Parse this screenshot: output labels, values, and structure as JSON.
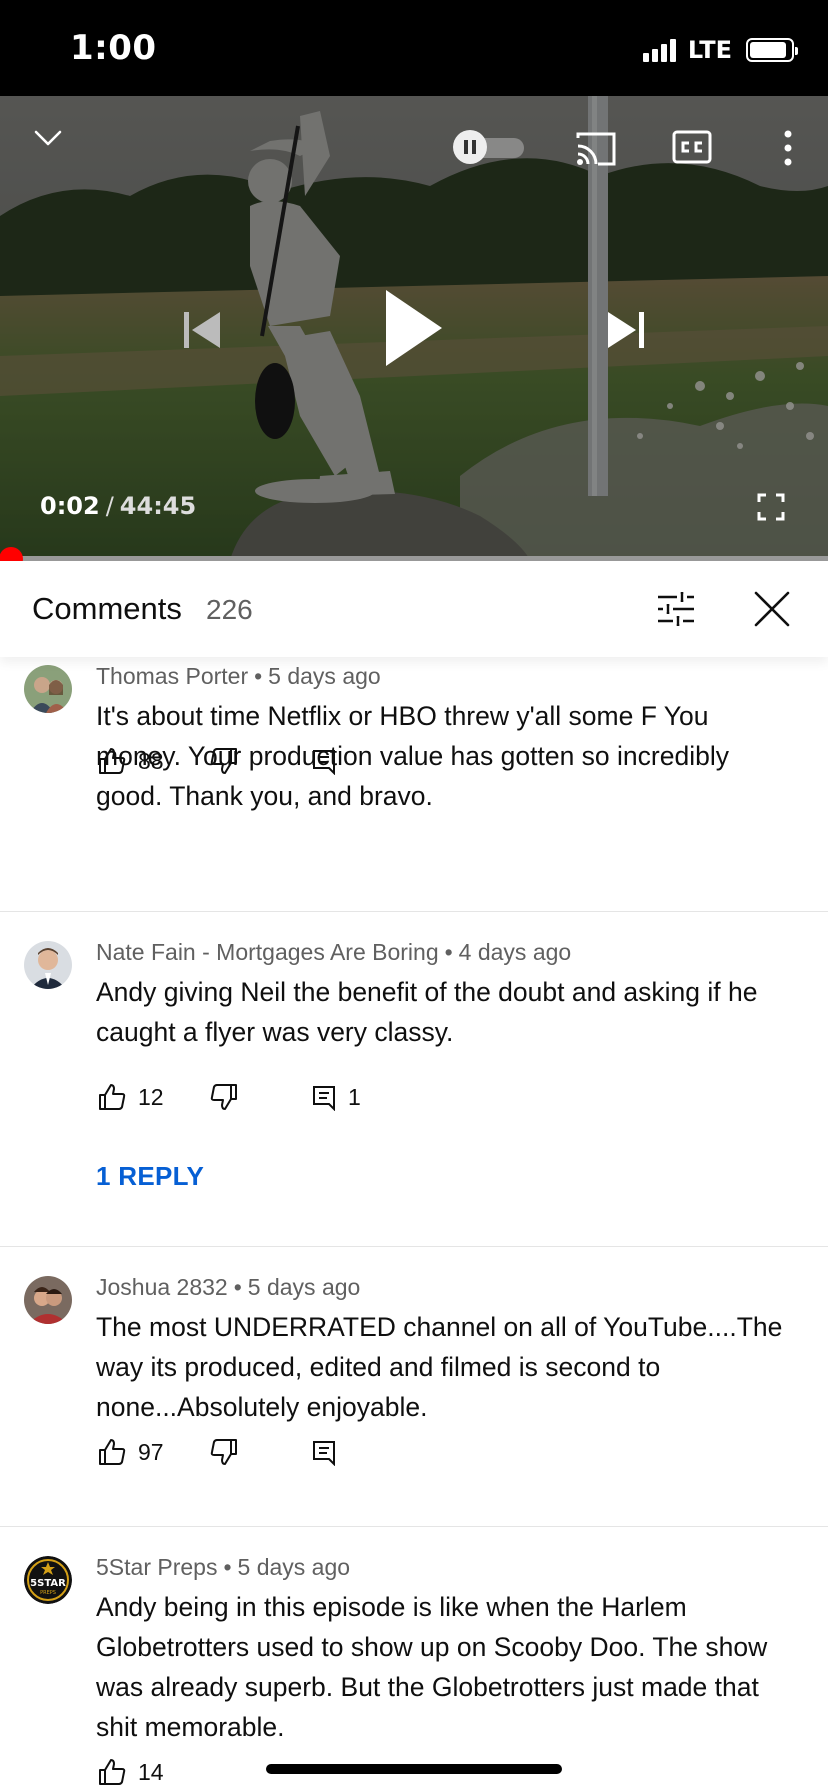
{
  "status_bar": {
    "time": "1:00",
    "network": "LTE",
    "signal_bars": 4,
    "battery_level": 0.9
  },
  "player": {
    "current_time": "0:02",
    "separator": "/",
    "duration": "44:45",
    "progress": 0.0007,
    "icons": [
      "chevron-down-icon",
      "autoplay-toggle-icon",
      "cast-icon",
      "captions-icon",
      "more-vert-icon",
      "previous-icon",
      "play-icon",
      "next-icon",
      "fullscreen-icon"
    ],
    "accent_color": "#ff0000"
  },
  "comments_panel": {
    "title": "Comments",
    "count": "226",
    "icons": [
      "sort-filter-icon",
      "close-icon"
    ]
  },
  "comments": [
    {
      "author": "Thomas Porter",
      "age": "5 days ago",
      "text": "It's about time Netflix or HBO threw y'all some F You money. Your production value has gotten so incredibly good. Thank you, and bravo.",
      "likes": "88",
      "replies_count": ""
    },
    {
      "author": "Nate Fain - Mortgages Are Boring",
      "age": "4 days ago",
      "text": "Andy giving Neil the benefit of the doubt and asking if he caught a flyer was very classy.",
      "likes": "12",
      "replies_count": "1",
      "reply_link": "1 REPLY"
    },
    {
      "author": "Joshua 2832",
      "age": "5 days ago",
      "text": "The most UNDERRATED channel on all of YouTube....The  way its produced, edited and filmed is second to none...Absolutely enjoyable.",
      "likes": "97",
      "replies_count": ""
    },
    {
      "author": "5Star Preps",
      "age": "5 days ago",
      "text": "Andy being in this episode is like when the Harlem Globetrotters used to show up on Scooby Doo. The show was already superb. But the Globetrotters just made that shit memorable.",
      "likes": "14",
      "replies_count": ""
    }
  ],
  "colors": {
    "link": "#065fd4",
    "secondary_text": "#606060",
    "divider": "#e5e5e5"
  }
}
